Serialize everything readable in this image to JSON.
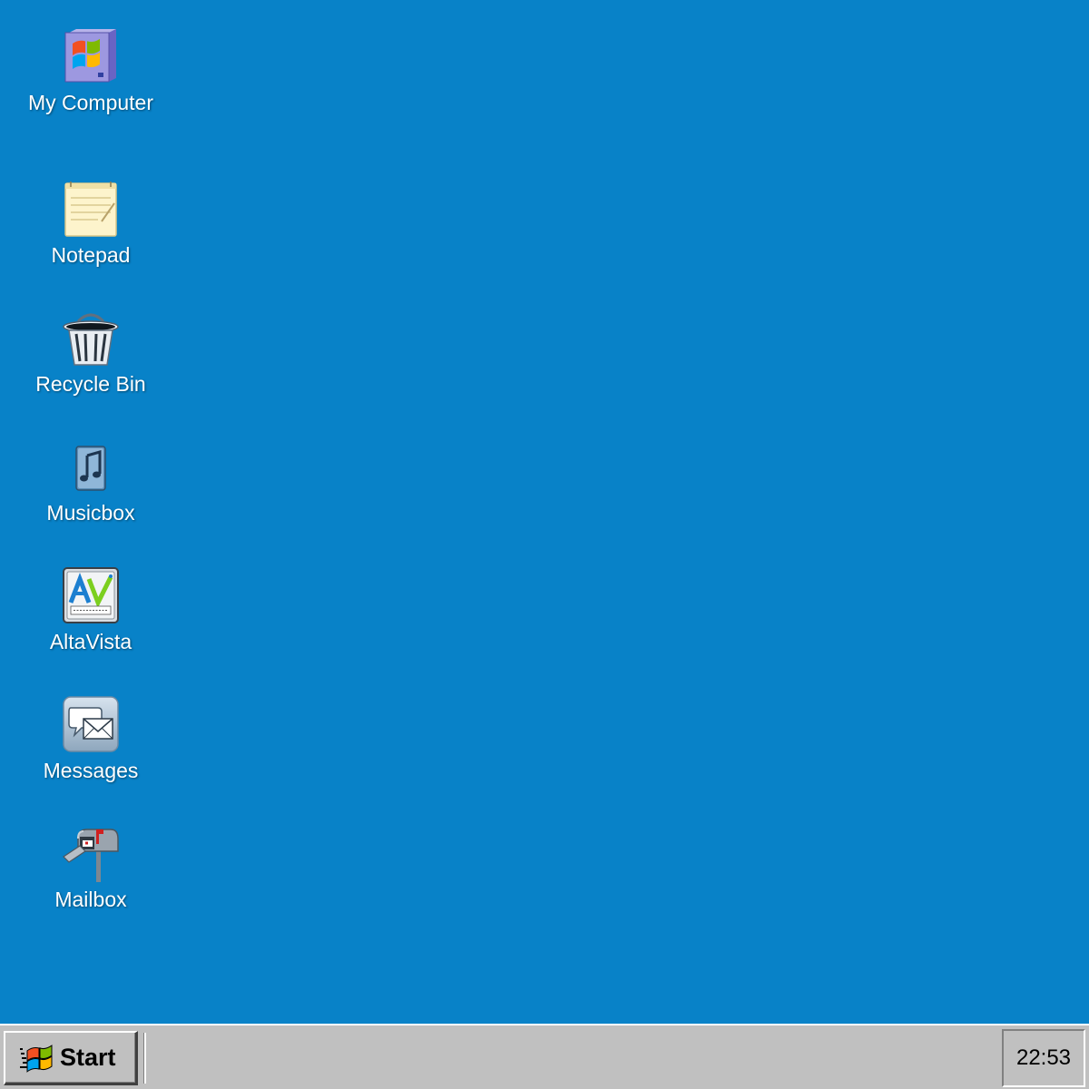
{
  "desktop": {
    "background_color": "#0882c8",
    "icons": [
      {
        "label": "My Computer",
        "icon": "my-computer-icon"
      },
      {
        "label": "Notepad",
        "icon": "notepad-icon"
      },
      {
        "label": "Recycle Bin",
        "icon": "recycle-bin-icon"
      },
      {
        "label": "Musicbox",
        "icon": "musicbox-icon"
      },
      {
        "label": "AltaVista",
        "icon": "altavista-icon"
      },
      {
        "label": "Messages",
        "icon": "messages-icon"
      },
      {
        "label": "Mailbox",
        "icon": "mailbox-icon"
      }
    ]
  },
  "taskbar": {
    "start_label": "Start",
    "start_icon": "windows-logo-icon",
    "clock": "22:53"
  }
}
